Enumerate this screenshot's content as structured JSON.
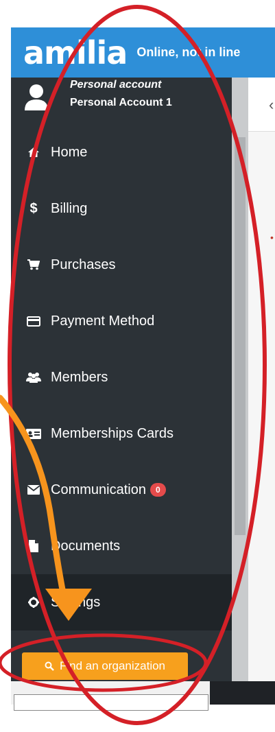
{
  "header": {
    "logo": "amilia",
    "tagline": "Online, not in line",
    "color": "#2e8fd8"
  },
  "account": {
    "type": "Personal account",
    "name": "Personal Account 1"
  },
  "menu": {
    "items": [
      {
        "label": "Home",
        "icon": "home-icon"
      },
      {
        "label": "Billing",
        "icon": "dollar-icon"
      },
      {
        "label": "Purchases",
        "icon": "cart-icon"
      },
      {
        "label": "Payment Method",
        "icon": "credit-card-icon"
      },
      {
        "label": "Members",
        "icon": "users-icon"
      },
      {
        "label": "Memberships Cards",
        "icon": "id-card-icon"
      },
      {
        "label": "Communication",
        "icon": "envelope-icon",
        "badge": "0"
      },
      {
        "label": "Documents",
        "icon": "file-icon"
      },
      {
        "label": "Settings",
        "icon": "gear-icon",
        "active": true
      }
    ]
  },
  "find_button": {
    "label": "Find an organization",
    "icon": "search-icon",
    "color": "#f7a01d"
  },
  "colors": {
    "sidebar": "#2c3237",
    "badge": "#e54b4b",
    "annotation_circle": "#d42027",
    "annotation_arrow": "#f7941d"
  }
}
